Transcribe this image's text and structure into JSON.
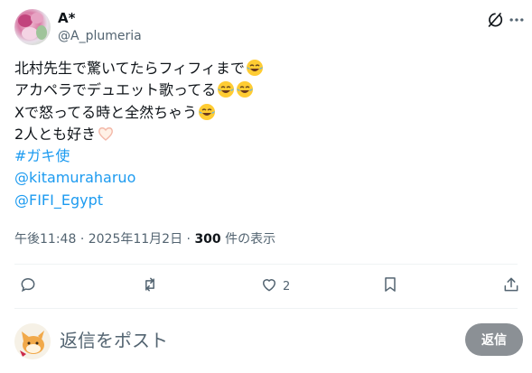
{
  "author": {
    "display_name": "A*",
    "handle": "@A_plumeria"
  },
  "post": {
    "lines": [
      {
        "text": "北村先生で驚いてたらフィフィまで",
        "emojis": [
          "joy-emoji"
        ]
      },
      {
        "text": "アカペラでデュエット歌ってる",
        "emojis": [
          "joy-emoji",
          "joy-emoji"
        ]
      },
      {
        "text": "Xで怒ってる時と全然ちゃう",
        "emojis": [
          "joy-emoji"
        ]
      },
      {
        "text": "2人とも好き",
        "emojis": [
          "heart-hands-emoji"
        ]
      }
    ],
    "hashtag": "#ガキ使",
    "mentions": [
      "@kitamuraharuo",
      "@FIFI_Egypt"
    ]
  },
  "meta": {
    "time": "午後11:48",
    "separator": "·",
    "date": "2025年11月2日",
    "view_count": "300",
    "view_suffix": "件の表示"
  },
  "actions": {
    "like_count": "2"
  },
  "reply": {
    "placeholder": "返信をポスト",
    "button_label": "返信"
  },
  "colors": {
    "link": "#1d9bf0",
    "secondary_text": "#536471",
    "reply_button": "#8b9095"
  },
  "icons": [
    "grok-icon",
    "more-icon",
    "reply-icon",
    "repost-icon",
    "like-icon",
    "bookmark-icon",
    "share-icon"
  ]
}
